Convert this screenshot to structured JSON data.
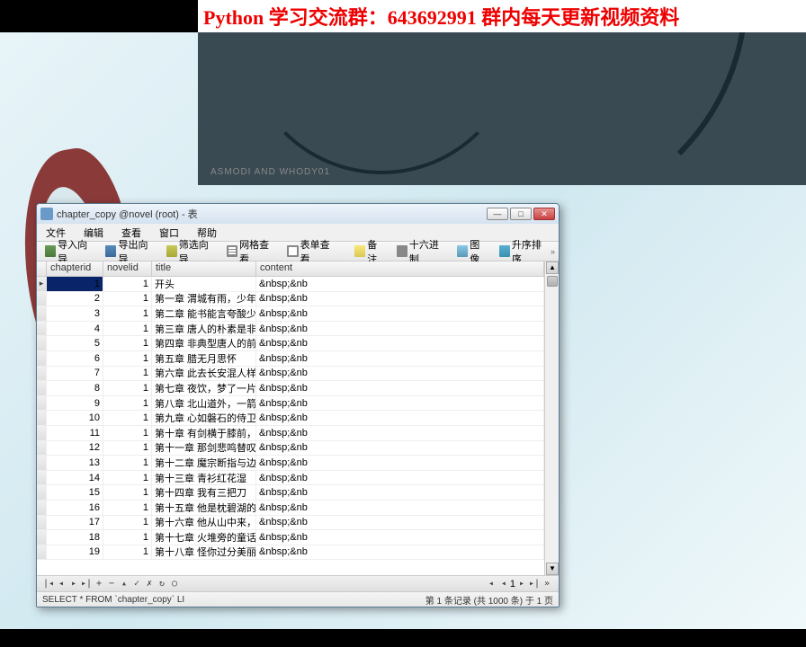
{
  "banner": {
    "text": "Python 学习交流群：643692991 群内每天更新视频资料"
  },
  "desktop": {
    "credit": "ASMODI AND WHODY01"
  },
  "window": {
    "title": "chapter_copy @novel (root) - 表",
    "menus": [
      "文件",
      "编辑",
      "查看",
      "窗口",
      "帮助"
    ],
    "toolbar": {
      "import": "导入向导",
      "export": "导出向导",
      "filter": "筛选向导",
      "gridview": "网格查看",
      "formview": "表单查看",
      "note": "备注",
      "hex": "十六进制",
      "image": "图像",
      "sort": "升序排序"
    },
    "columns": {
      "c1": "chapterid",
      "c2": "novelid",
      "c3": "title",
      "c4": "content"
    },
    "rows": [
      {
        "id": "1",
        "nid": "1",
        "title": "开头",
        "content": "&nbsp;&nb"
      },
      {
        "id": "2",
        "nid": "1",
        "title": "第一章 渭城有雨，少年有衿",
        "content": "&nbsp;&nb"
      },
      {
        "id": "3",
        "nid": "1",
        "title": "第二章 能书能言夸酸少年",
        "content": "&nbsp;&nb"
      },
      {
        "id": "4",
        "nid": "1",
        "title": "第三章 唐人的朴素是非观",
        "content": "&nbsp;&nb"
      },
      {
        "id": "5",
        "nid": "1",
        "title": "第四章 非典型唐人的前路抒",
        "content": "&nbsp;&nb"
      },
      {
        "id": "6",
        "nid": "1",
        "title": "第五章 腊无月思怀",
        "content": "&nbsp;&nb"
      },
      {
        "id": "7",
        "nid": "1",
        "title": "第六章 此去长安混人样",
        "content": "&nbsp;&nb"
      },
      {
        "id": "8",
        "nid": "1",
        "title": "第七章 夜饮，梦了一片海",
        "content": "&nbsp;&nb"
      },
      {
        "id": "9",
        "nid": "1",
        "title": "第八章 北山道外，一箭南来",
        "content": "&nbsp;&nb"
      },
      {
        "id": "10",
        "nid": "1",
        "title": "第九章 心如磐石的侍卫们",
        "content": "&nbsp;&nb"
      },
      {
        "id": "11",
        "nid": "1",
        "title": "第十章 有剑横于膝前，有变",
        "content": "&nbsp;&nb"
      },
      {
        "id": "12",
        "nid": "1",
        "title": "第十一章 那剑悲鸣替叹",
        "content": "&nbsp;&nb"
      },
      {
        "id": "13",
        "nid": "1",
        "title": "第十二章 魔宗断指与边军伏",
        "content": "&nbsp;&nb"
      },
      {
        "id": "14",
        "nid": "1",
        "title": "第十三章 青衫红花湿",
        "content": "&nbsp;&nb"
      },
      {
        "id": "15",
        "nid": "1",
        "title": "第十四章 我有三把刀",
        "content": "&nbsp;&nb"
      },
      {
        "id": "16",
        "nid": "1",
        "title": "第十五章 他是枕碧湖的砍柴",
        "content": "&nbsp;&nb"
      },
      {
        "id": "17",
        "nid": "1",
        "title": "第十六章 他从山中来，带着",
        "content": "&nbsp;&nb"
      },
      {
        "id": "18",
        "nid": "1",
        "title": "第十七章 火堆旁的童话",
        "content": "&nbsp;&nb"
      },
      {
        "id": "19",
        "nid": "1",
        "title": "第十八章 怪你过分美丽",
        "content": "&nbsp;&nb"
      }
    ],
    "nav_page_input": "1",
    "status": {
      "sql": "SELECT * FROM `chapter_copy` LI",
      "right": "第 1 条记录 (共 1000 条) 于 1 页"
    }
  }
}
